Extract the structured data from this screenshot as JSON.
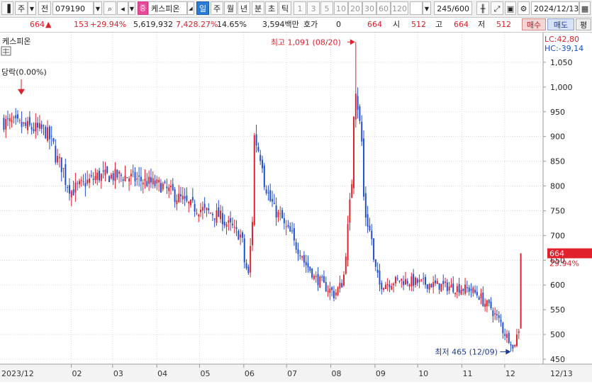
{
  "toolbar": {
    "market_label": "주",
    "type_label": "전",
    "code": "079190",
    "stock_tag": "증",
    "stock_name": "케스피온",
    "periods": [
      "일",
      "주",
      "월",
      "년",
      "분",
      "초",
      "틱"
    ],
    "intervals": [
      "1",
      "3",
      "5",
      "10",
      "20",
      "30",
      "60",
      "120"
    ],
    "count": "245/600",
    "date": "2024/12/13"
  },
  "info": {
    "price": "664",
    "change": "153",
    "change_pct": "+29.94%",
    "volume": "5,619,932",
    "volume_pct": "7,428.27%",
    "turnover": "14.65%",
    "amount": "3,594백만",
    "hoga_label": "호가",
    "hoga_value": "0",
    "ask": "664",
    "open_label": "시",
    "open": "512",
    "high_label": "고",
    "high": "664",
    "low_label": "저",
    "low": "512",
    "buy_label": "매수",
    "sell_label": "매도",
    "flat_label": "평"
  },
  "chart": {
    "legend": "케스피온",
    "lc": "LC:42,80",
    "hc": "HC:-39,14",
    "prev_note": "당락(0.00%)",
    "high_note": "최고 1,091 (08/20)",
    "low_note": "최저 465 (12/09)",
    "current_price": "664",
    "current_pct": "29.94%"
  },
  "chart_data": {
    "type": "candlestick",
    "y_ticks": [
      "1,050",
      "1,000",
      "950",
      "900",
      "850",
      "800",
      "750",
      "700",
      "650",
      "600",
      "550",
      "500",
      "450"
    ],
    "ylim": [
      440,
      1110
    ],
    "x_ticks": [
      "2023/12",
      "02",
      "03",
      "04",
      "05",
      "06",
      "07",
      "08",
      "09",
      "10",
      "11",
      "12",
      "12/13"
    ],
    "anchors": [
      {
        "date": "2023/12/15",
        "close": 930
      },
      {
        "date": "2024/01/15",
        "close": 910
      },
      {
        "date": "2024/02/01",
        "close": 790
      },
      {
        "date": "2024/02/20",
        "close": 820
      },
      {
        "date": "2024/03/10",
        "close": 820
      },
      {
        "date": "2024/04/05",
        "close": 800
      },
      {
        "date": "2024/04/25",
        "close": 760
      },
      {
        "date": "2024/05/15",
        "close": 740
      },
      {
        "date": "2024/05/30",
        "close": 700
      },
      {
        "date": "2024/06/05",
        "close": 620
      },
      {
        "date": "2024/06/10",
        "close": 900
      },
      {
        "date": "2024/06/20",
        "close": 770
      },
      {
        "date": "2024/07/05",
        "close": 700
      },
      {
        "date": "2024/07/20",
        "close": 620
      },
      {
        "date": "2024/08/05",
        "close": 580
      },
      {
        "date": "2024/08/12",
        "close": 620
      },
      {
        "date": "2024/08/20",
        "close": 1000
      },
      {
        "date": "2024/08/27",
        "close": 740
      },
      {
        "date": "2024/09/05",
        "close": 600
      },
      {
        "date": "2024/09/20",
        "close": 610
      },
      {
        "date": "2024/10/15",
        "close": 600
      },
      {
        "date": "2024/11/10",
        "close": 590
      },
      {
        "date": "2024/11/25",
        "close": 545
      },
      {
        "date": "2024/12/09",
        "close": 470
      },
      {
        "date": "2024/12/12",
        "close": 511
      },
      {
        "date": "2024/12/13",
        "close": 664
      }
    ],
    "high": 1091,
    "low": 465,
    "last": 664,
    "up_color": "#e0202a",
    "down_color": "#1f4fd0"
  }
}
